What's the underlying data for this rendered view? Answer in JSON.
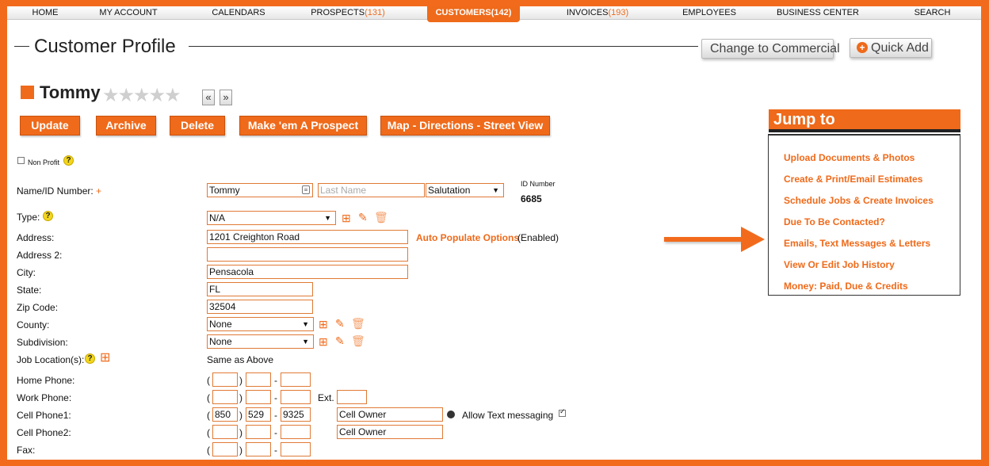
{
  "nav": {
    "home": "HOME",
    "my_account": "MY ACCOUNT",
    "calendars": "CALENDARS",
    "prospects": "PROSPECTS",
    "prospects_count": "(131)",
    "customers": "CUSTOMERS",
    "customers_count": "(142)",
    "invoices": "INVOICES",
    "invoices_count": "(193)",
    "employees": "EMPLOYEES",
    "business_center": "BUSINESS CENTER",
    "search": "SEARCH"
  },
  "header": {
    "title": "Customer Profile",
    "change_commercial": "Change to Commercial",
    "quick_add": "Quick Add"
  },
  "customer": {
    "name": "Tommy",
    "stars": "★★★★★",
    "rating": 0,
    "prev": "«",
    "next": "»"
  },
  "actions": {
    "update": "Update",
    "archive": "Archive",
    "delete": "Delete",
    "make_prospect": "Make 'em A Prospect",
    "map": "Map - Directions - Street View"
  },
  "form": {
    "non_profit": "Non Profit",
    "name_label": "Name/ID Number:",
    "required_mark": "+",
    "first_name": "Tommy",
    "last_name_placeholder": "Last Name",
    "salutation": "Salutation",
    "id_number_label": "ID Number",
    "id_number": "6685",
    "type_label": "Type:",
    "type_value": "N/A",
    "address_label": "Address:",
    "address_value": "1201 Creighton Road",
    "auto_populate": "Auto Populate Options",
    "auto_populate_status": "(Enabled)",
    "address2_label": "Address 2:",
    "address2_value": "",
    "city_label": "City:",
    "city_value": "Pensacola",
    "state_label": "State:",
    "state_value": "FL",
    "zip_label": "Zip Code:",
    "zip_value": "32504",
    "county_label": "County:",
    "county_value": "None",
    "subdivision_label": "Subdivision:",
    "subdivision_value": "None",
    "job_location_label": "Job Location(s):",
    "job_location_value": "Same as Above",
    "home_phone_label": "Home Phone:",
    "work_phone_label": "Work Phone:",
    "ext_label": "Ext.",
    "cell1_label": "Cell Phone1:",
    "cell1_area": "850",
    "cell1_prefix": "529",
    "cell1_line": "9325",
    "cell1_owner": "Cell Owner",
    "allow_text": "Allow Text messaging",
    "cell2_label": "Cell Phone2:",
    "cell2_owner": "Cell Owner",
    "fax_label": "Fax:"
  },
  "jump": {
    "title": "Jump to",
    "links": [
      "Upload Documents & Photos",
      "Create & Print/Email Estimates",
      "Schedule Jobs & Create Invoices",
      "Due To Be Contacted?",
      "Emails, Text Messages & Letters",
      "View Or Edit Job History",
      "Money: Paid, Due & Credits"
    ]
  },
  "colors": {
    "brand_orange": "#ef6a1a",
    "frame_orange": "#f26b1d"
  }
}
